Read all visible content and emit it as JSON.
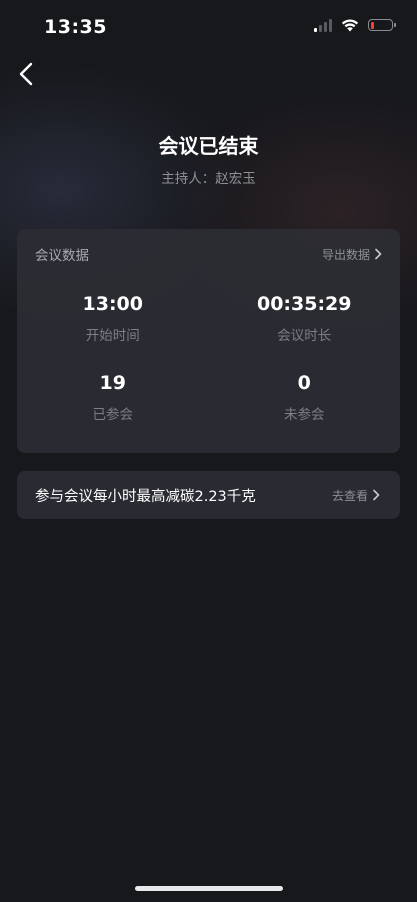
{
  "status_bar": {
    "time": "13:35",
    "icons": [
      "cellular-signal-icon",
      "wifi-icon",
      "battery-low-icon"
    ],
    "battery_color": "#ff3b30"
  },
  "nav": {
    "back_icon": "chevron-left-icon"
  },
  "header": {
    "title": "会议已结束",
    "host_line": "主持人：赵宏玉"
  },
  "meeting_data": {
    "title": "会议数据",
    "export_label": "导出数据",
    "stats": [
      {
        "value": "13:00",
        "label": "开始时间"
      },
      {
        "value": "00:35:29",
        "label": "会议时长"
      },
      {
        "value": "19",
        "label": "已参会"
      },
      {
        "value": "0",
        "label": "未参会"
      }
    ]
  },
  "carbon": {
    "text": "参与会议每小时最高减碳2.23千克",
    "link_label": "去查看"
  },
  "colors": {
    "background": "#17181c",
    "card": "#2c2e34",
    "secondary_text": "#8e9096"
  }
}
